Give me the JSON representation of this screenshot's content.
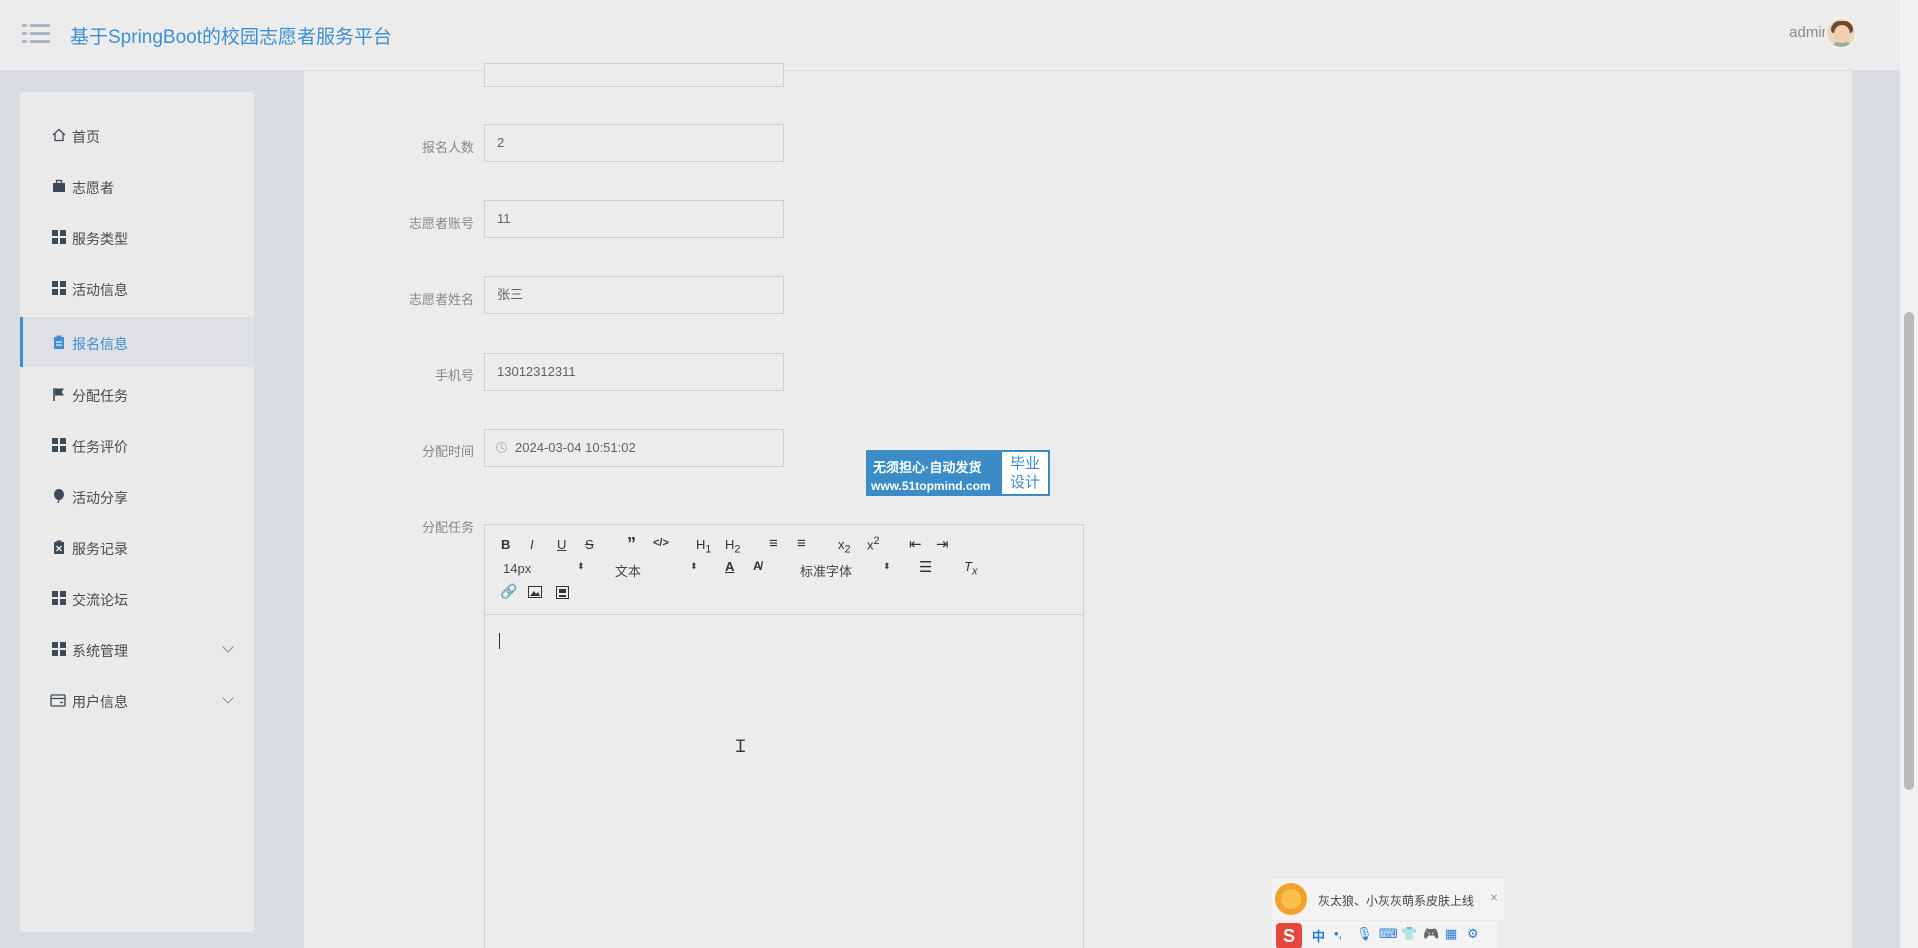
{
  "header": {
    "title": "基于SpringBoot的校园志愿者服务平台",
    "user": "admin"
  },
  "sidebar": {
    "items": [
      {
        "label": "首页",
        "icon": "home-icon"
      },
      {
        "label": "志愿者",
        "icon": "briefcase-icon"
      },
      {
        "label": "服务类型",
        "icon": "grid-icon"
      },
      {
        "label": "活动信息",
        "icon": "grid-icon"
      },
      {
        "label": "报名信息",
        "icon": "clipboard-icon",
        "active": true
      },
      {
        "label": "分配任务",
        "icon": "flag-icon"
      },
      {
        "label": "任务评价",
        "icon": "grid-icon"
      },
      {
        "label": "活动分享",
        "icon": "balloon-icon"
      },
      {
        "label": "服务记录",
        "icon": "trash-list-icon"
      },
      {
        "label": "交流论坛",
        "icon": "grid-icon"
      },
      {
        "label": "系统管理",
        "icon": "grid-icon",
        "expandable": true
      },
      {
        "label": "用户信息",
        "icon": "card-icon",
        "expandable": true
      }
    ]
  },
  "form": {
    "fields": [
      {
        "label": "报名人数",
        "value": "2"
      },
      {
        "label": "志愿者账号",
        "value": "11"
      },
      {
        "label": "志愿者姓名",
        "value": "张三"
      },
      {
        "label": "手机号",
        "value": "13012312311"
      },
      {
        "label": "分配时间",
        "value": "2024-03-04 10:51:02"
      }
    ],
    "task_label": "分配任务"
  },
  "editor": {
    "font_size": "14px",
    "text_type": "文本",
    "font_family": "标准字体"
  },
  "ad": {
    "line1": "无须担心·自动发货",
    "line2": "www.51topmind.com",
    "right_top": "毕业",
    "right_bottom": "设计"
  },
  "ime": {
    "notice": "灰太狼、小灰灰萌系皮肤上线",
    "logo": "S",
    "mode": "中"
  },
  "colors": {
    "accent": "#3d8fd4",
    "page_bg": "#ececec",
    "sidebar_bg": "#eaeaea"
  }
}
